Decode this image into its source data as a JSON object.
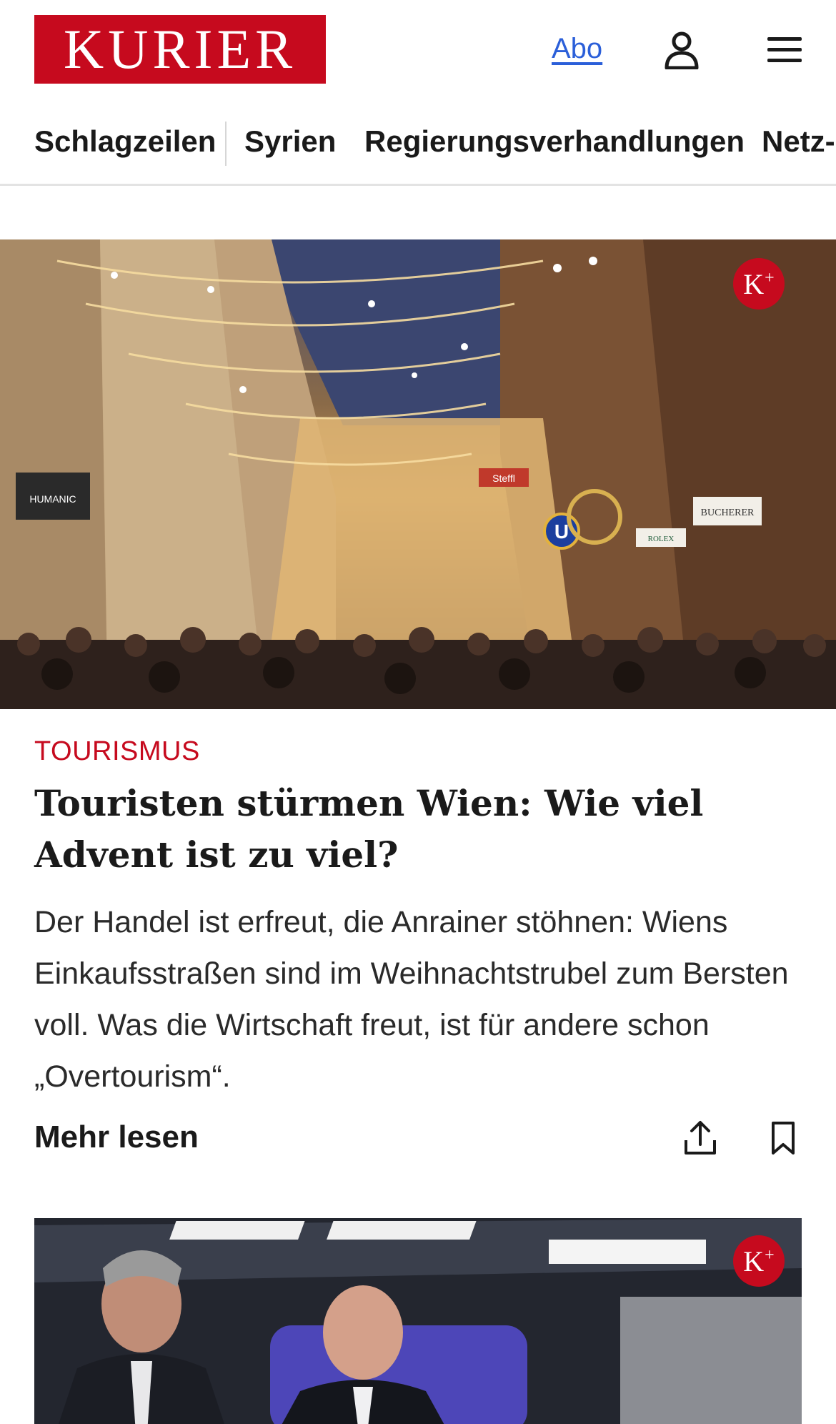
{
  "header": {
    "logo": "KURIER",
    "abo_label": "Abo",
    "user_icon": "user-icon",
    "menu_icon": "hamburger-menu-icon"
  },
  "nav": {
    "items": [
      {
        "label": "Schlagzeilen"
      },
      {
        "label": "Syrien"
      },
      {
        "label": "Regierungsverhandlungen"
      },
      {
        "label": "Netz-"
      }
    ]
  },
  "article1": {
    "premium_badge": "K+",
    "category": "TOURISMUS",
    "headline": "Touristen stürmen Wien: Wie viel Advent ist zu viel?",
    "teaser": "Der Handel ist erfreut, die Anrainer stöhnen: Wiens Einkaufsstraßen sind im Weihnachtstrubel zum Bersten voll. Was die Wirtschaft freut, ist für andere schon „Overtourism“.",
    "more_label": "Mehr lesen",
    "share_icon": "share-icon",
    "bookmark_icon": "bookmark-icon",
    "image_labels": {
      "shop1": "HUMANIC",
      "shop2": "BUCHERER",
      "shop3": "ROLEX",
      "shop4": "Steffl",
      "subway": "U"
    }
  },
  "article2": {
    "premium_badge": "K+"
  },
  "colors": {
    "brand_red": "#c60a1e",
    "link_blue": "#2b5fd9"
  }
}
